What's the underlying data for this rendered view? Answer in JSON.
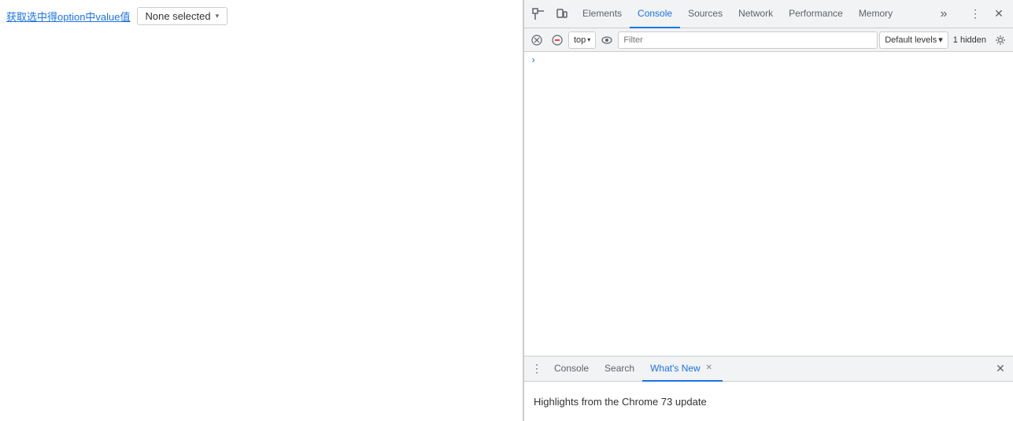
{
  "webpage": {
    "label": "获取选中得option中value值",
    "dropdown": {
      "label": "None selected",
      "caret": "▾"
    }
  },
  "devtools": {
    "top_bar": {
      "inspect_icon": "⬚",
      "device_icon": "⬜",
      "tabs": [
        {
          "id": "elements",
          "label": "Elements",
          "active": false
        },
        {
          "id": "console",
          "label": "Console",
          "active": true
        },
        {
          "id": "sources",
          "label": "Sources",
          "active": false
        },
        {
          "id": "network",
          "label": "Network",
          "active": false
        },
        {
          "id": "performance",
          "label": "Performance",
          "active": false
        },
        {
          "id": "memory",
          "label": "Memory",
          "active": false
        }
      ],
      "more_label": "⋮",
      "more_tabs_icon": "»",
      "close_icon": "✕"
    },
    "console_toolbar": {
      "clear_icon": "🚫",
      "filter_icon": "⬚",
      "context_label": "top",
      "context_caret": "▾",
      "eye_icon": "👁",
      "filter_placeholder": "Filter",
      "levels_label": "Default levels",
      "levels_caret": "▾",
      "hidden_text": "1 hidden",
      "settings_icon": "⚙"
    },
    "console_output": {
      "lines": [
        {
          "prompt": ">",
          "text": ""
        }
      ]
    },
    "drawer": {
      "menu_icon": "⋮",
      "tabs": [
        {
          "id": "console",
          "label": "Console",
          "active": false,
          "closeable": false
        },
        {
          "id": "search",
          "label": "Search",
          "active": false,
          "closeable": false
        },
        {
          "id": "whats-new",
          "label": "What's New",
          "active": true,
          "closeable": true
        }
      ],
      "close_icon": "✕",
      "content": "Highlights from the Chrome 73 update"
    }
  }
}
